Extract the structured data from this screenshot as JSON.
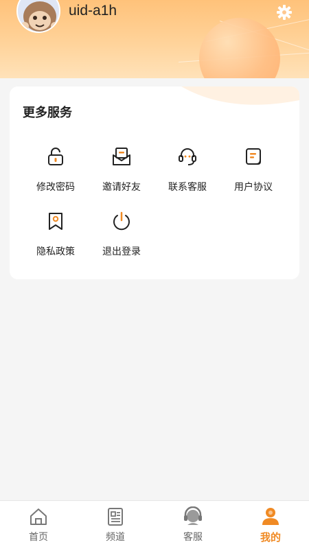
{
  "user": {
    "username": "uid-a1h"
  },
  "services": {
    "title": "更多服务",
    "items": [
      {
        "label": "修改密码",
        "icon": "lock-icon"
      },
      {
        "label": "邀请好友",
        "icon": "invite-mail-icon"
      },
      {
        "label": "联系客服",
        "icon": "headset-icon"
      },
      {
        "label": "用户协议",
        "icon": "agreement-doc-icon"
      },
      {
        "label": "隐私政策",
        "icon": "bookmark-icon"
      },
      {
        "label": "退出登录",
        "icon": "power-icon"
      }
    ]
  },
  "tabbar": {
    "items": [
      {
        "label": "首页",
        "icon": "home-icon"
      },
      {
        "label": "频道",
        "icon": "channel-icon"
      },
      {
        "label": "客服",
        "icon": "customer-service-icon"
      },
      {
        "label": "我的",
        "icon": "user-icon",
        "active": true
      }
    ]
  },
  "colors": {
    "accent": "#f08a24",
    "header": "#ffc27a",
    "background": "#f5f5f5"
  }
}
